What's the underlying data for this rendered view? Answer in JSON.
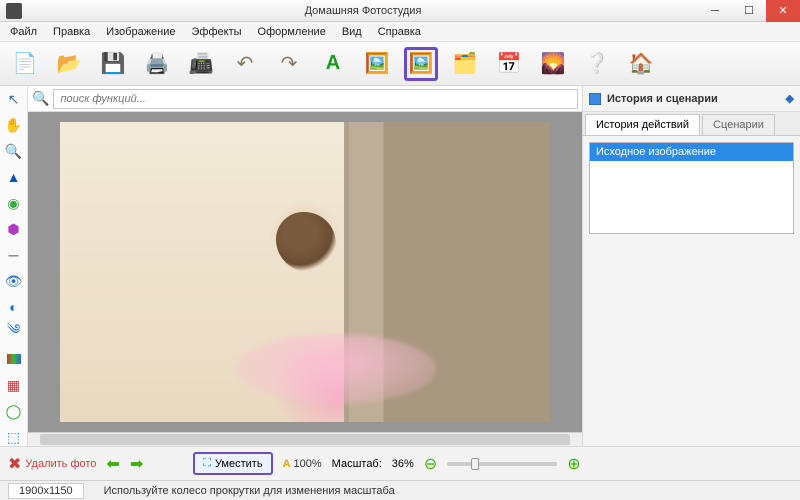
{
  "window": {
    "title": "Домашняя Фотостудия"
  },
  "menu": [
    "Файл",
    "Правка",
    "Изображение",
    "Эффекты",
    "Оформление",
    "Вид",
    "Справка"
  ],
  "toolbar": {
    "icons": [
      "new-image",
      "open",
      "save",
      "print",
      "scan",
      "undo",
      "redo",
      "text",
      "overlay",
      "crop-highlight",
      "frame",
      "calendar",
      "export-image",
      "help",
      "home"
    ]
  },
  "search": {
    "placeholder": "поиск функций..."
  },
  "left_tools": [
    "pointer",
    "hand",
    "zoom",
    "paint",
    "eyedropper",
    "stamp",
    "line",
    "eye",
    "contrast",
    "swirl",
    "levels",
    "layers",
    "selection",
    "crop"
  ],
  "right_panel": {
    "title": "История и сценарии",
    "tabs": [
      "История действий",
      "Сценарии"
    ],
    "history": [
      "Исходное изображение"
    ]
  },
  "bottom": {
    "delete_label": "Удалить фото",
    "fit_label": "Уместить",
    "zoom100": "100%",
    "scale_label": "Масштаб:",
    "scale_value": "36%"
  },
  "status": {
    "dimensions": "1900x1150",
    "hint": "Используйте колесо прокрутки для изменения масштаба"
  }
}
